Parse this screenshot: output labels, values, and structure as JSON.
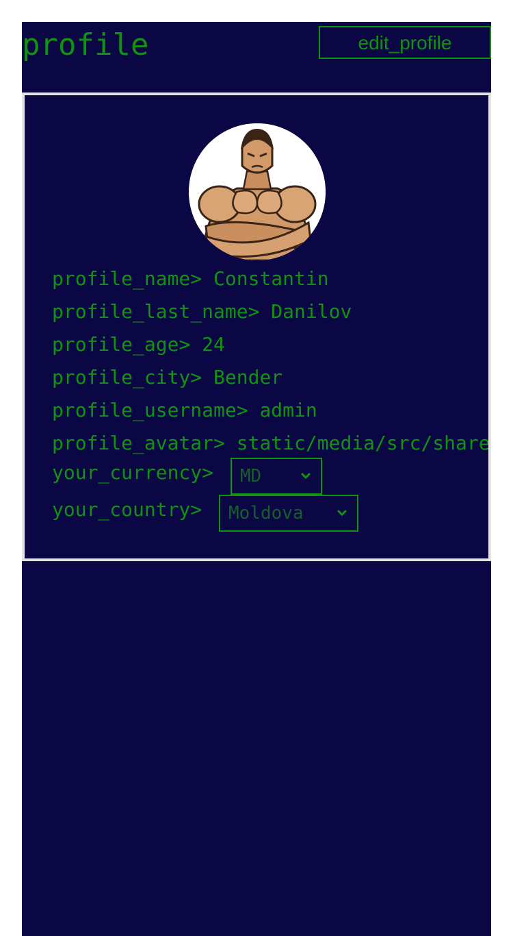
{
  "header": {
    "title": "profile",
    "edit_label": "edit_profile"
  },
  "avatar": {
    "icon": "muscular-man-avatar"
  },
  "profile": {
    "rows": [
      {
        "label": "profile_name",
        "value": "Constantin"
      },
      {
        "label": "profile_last_name",
        "value": "Danilov"
      },
      {
        "label": "profile_age",
        "value": "24"
      },
      {
        "label": "profile_city",
        "value": "Bender"
      },
      {
        "label": "profile_username",
        "value": "admin"
      },
      {
        "label": "profile_avatar",
        "value": "static/media/src/share"
      }
    ],
    "separator": "> ",
    "currency": {
      "label": "your_currency",
      "value": "MD"
    },
    "country": {
      "label": "your_country",
      "value": "Moldova"
    }
  },
  "colors": {
    "background": "#0a0744",
    "accent": "#119211",
    "card_border": "#e4e4e4"
  }
}
